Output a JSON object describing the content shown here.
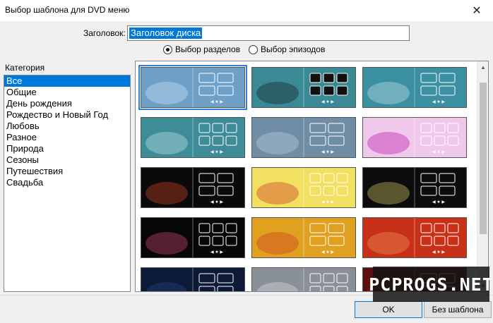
{
  "window": {
    "title": "Выбор шаблона для DVD меню"
  },
  "heading": {
    "label": "Заголовок:",
    "value": "Заголовок диска"
  },
  "mode": {
    "options": [
      {
        "label": "Выбор разделов",
        "selected": true
      },
      {
        "label": "Выбор эпизодов",
        "selected": false
      }
    ]
  },
  "categories": {
    "label": "Категория",
    "items": [
      "Все",
      "Общие",
      "День рождения",
      "Рождество и Новый Год",
      "Любовь",
      "Разное",
      "Природа",
      "Сезоны",
      "Путешествия",
      "Свадьба"
    ],
    "selected_index": 0
  },
  "templates": {
    "selected_index": 0,
    "items": [
      {
        "theme": "blue-mist",
        "bg": "#6fa0c8",
        "accent": "#d8ecf8"
      },
      {
        "theme": "teal-dark-frames",
        "bg": "#3a8a96",
        "accent": "#111111"
      },
      {
        "theme": "teal-lines",
        "bg": "#3a8fa0",
        "accent": "#d8ecf2"
      },
      {
        "theme": "teal-ovals",
        "bg": "#3d8c98",
        "accent": "#d8eef2"
      },
      {
        "theme": "grey-blue",
        "bg": "#6f8ea6",
        "accent": "#c8d8e4"
      },
      {
        "theme": "pink-balloons",
        "bg": "#f0c8ec",
        "accent": "#b000a0"
      },
      {
        "theme": "birthday-cake",
        "bg": "#0a0a0a",
        "accent": "#e84a2a"
      },
      {
        "theme": "christmas-yellow",
        "bg": "#f2e060",
        "accent": "#c82020"
      },
      {
        "theme": "christmas-tree",
        "bg": "#0c0c0c",
        "accent": "#f2e070"
      },
      {
        "theme": "fireworks",
        "bg": "#060606",
        "accent": "#f0508a"
      },
      {
        "theme": "gold-heart",
        "bg": "#e0a020",
        "accent": "#c83020"
      },
      {
        "theme": "red-heart",
        "bg": "#c83018",
        "accent": "#f0a060"
      },
      {
        "theme": "navy-dark",
        "bg": "#0c1a38",
        "accent": "#2a4a88"
      },
      {
        "theme": "photo-grey",
        "bg": "#8a9098",
        "accent": "#e8e8e8"
      },
      {
        "theme": "red-dark",
        "bg": "#5a1010",
        "accent": "#b02020"
      }
    ]
  },
  "buttons": {
    "ok": "OK",
    "no_template": "Без шаблона"
  },
  "watermark": {
    "text": "PCPROGS.NET"
  },
  "icons": {
    "close": "close-icon",
    "scroll_up": "arrow-up-icon",
    "scroll_down": "arrow-down-icon"
  }
}
